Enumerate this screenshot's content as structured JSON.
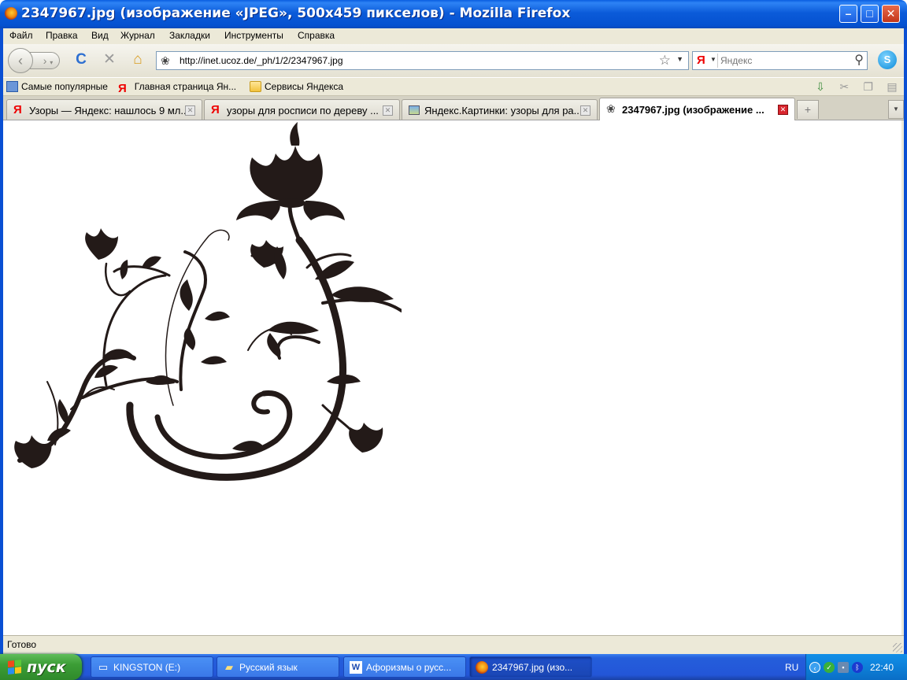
{
  "window": {
    "title": "2347967.jpg (изображение «JPEG», 500x459 пикселов) - Mozilla Firefox",
    "minimize": "–",
    "maximize": "□",
    "close": "✕"
  },
  "menu": [
    "Файл",
    "Правка",
    "Вид",
    "Журнал",
    "Закладки",
    "Инструменты",
    "Справка"
  ],
  "nav": {
    "back_glyph": "‹",
    "forward_glyph": "›",
    "reload_glyph": "C",
    "stop_glyph": "✕",
    "home_glyph": "⌂",
    "url": "http://inet.ucoz.de/_ph/1/2/2347967.jpg",
    "search_engine": "Я",
    "search_placeholder": "Яндекс"
  },
  "bookmarks": {
    "items": [
      {
        "label": "Самые популярные",
        "icon": "star-page-icon"
      },
      {
        "label": "Главная страница Ян...",
        "icon": "yandex-icon"
      },
      {
        "label": "Сервисы Яндекса",
        "icon": "folder-icon"
      }
    ]
  },
  "tabs": [
    {
      "label": "Узоры — Яндекс: нашлось 9 мл...",
      "icon": "yandex-icon",
      "active": false
    },
    {
      "label": "узоры для росписи по дереву ...",
      "icon": "yandex-icon",
      "active": false
    },
    {
      "label": "Яндекс.Картинки: узоры для ра...",
      "icon": "image-icon",
      "active": false
    },
    {
      "label": "2347967.jpg (изображение ...",
      "icon": "favicon-icon",
      "active": true
    }
  ],
  "content": {
    "image_width": 500,
    "image_height": 459
  },
  "status": {
    "text": "Готово"
  },
  "taskbar": {
    "start_label": "пуск",
    "buttons": [
      {
        "label": "KINGSTON (E:)",
        "icon": "drive-icon",
        "active": false
      },
      {
        "label": "Русский язык",
        "icon": "folder-icon",
        "active": false
      },
      {
        "label": "Афоризмы о русс...",
        "icon": "word-doc-icon",
        "active": false
      },
      {
        "label": "2347967.jpg (изо...",
        "icon": "firefox-icon",
        "active": true
      }
    ],
    "language": "RU",
    "clock": "22:40"
  },
  "colors": {
    "titlebar": "#0b5bd9",
    "start_green": "#3c9d36",
    "taskbar_blue": "#245edb",
    "artwork": "#231a18"
  }
}
